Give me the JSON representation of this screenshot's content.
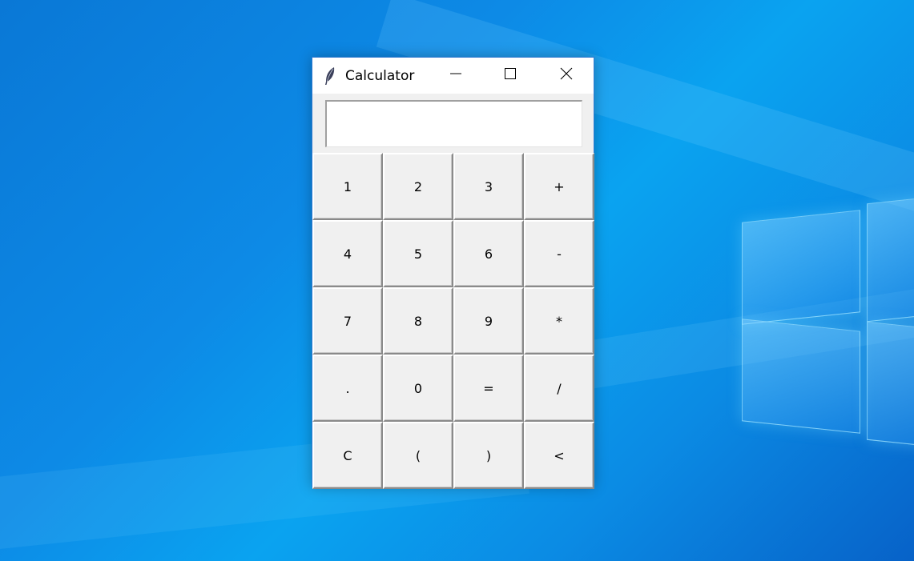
{
  "window": {
    "title": "Calculator",
    "icon": "feather-icon",
    "controls": [
      "minimize-icon",
      "maximize-icon",
      "close-icon"
    ]
  },
  "display": {
    "value": ""
  },
  "keypad": {
    "rows": [
      [
        "1",
        "2",
        "3",
        "+"
      ],
      [
        "4",
        "5",
        "6",
        "-"
      ],
      [
        "7",
        "8",
        "9",
        "*"
      ],
      [
        ".",
        "0",
        "=",
        "/"
      ],
      [
        "C",
        "(",
        ")",
        "<"
      ]
    ]
  },
  "colors": {
    "desktop_accent": "#0a8ae6",
    "window_border": "#2f7ad1",
    "button_face": "#f0f0f0"
  }
}
